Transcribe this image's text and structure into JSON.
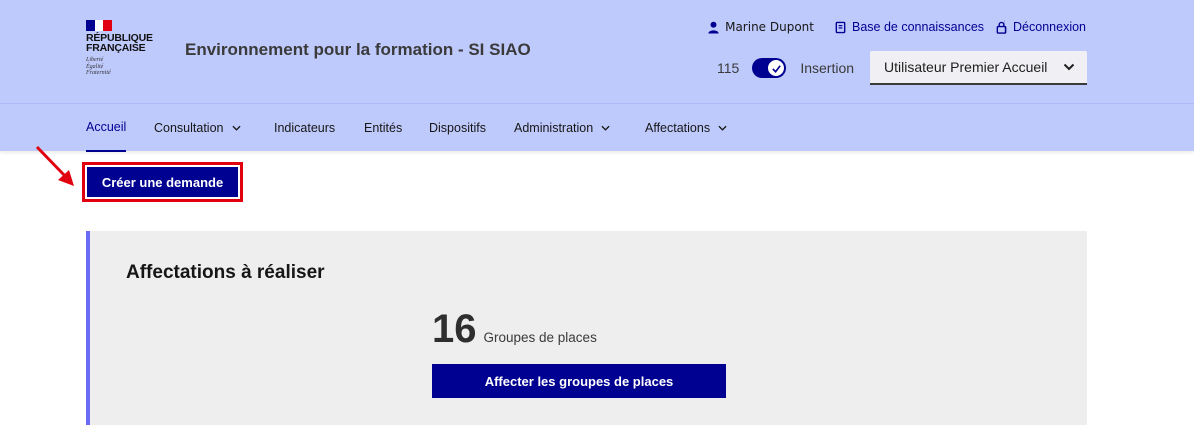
{
  "brand": {
    "flag_colors": [
      "#000091",
      "#ffffff",
      "#e1000f"
    ],
    "title_line1": "RÉPUBLIQUE",
    "title_line2": "FRANÇAISE",
    "motto_line1": "Liberté",
    "motto_line2": "Égalité",
    "motto_line3": "Fraternité"
  },
  "header": {
    "service_title": "Environnement pour la formation - SI SIAO",
    "user_name": "Marine Dupont",
    "knowledge_base_label": "Base de connaissances",
    "logout_label": "Déconnexion",
    "count": "115",
    "toggle_label": "Insertion",
    "toggle_on": true,
    "profile_select_value": "Utilisateur Premier Accueil"
  },
  "nav": {
    "items": [
      {
        "label": "Accueil",
        "active": true,
        "has_menu": false
      },
      {
        "label": "Consultation",
        "active": false,
        "has_menu": true
      },
      {
        "label": "Indicateurs",
        "active": false,
        "has_menu": false
      },
      {
        "label": "Entités",
        "active": false,
        "has_menu": false
      },
      {
        "label": "Dispositifs",
        "active": false,
        "has_menu": false
      },
      {
        "label": "Administration",
        "active": false,
        "has_menu": true
      },
      {
        "label": "Affectations",
        "active": false,
        "has_menu": true
      }
    ]
  },
  "actions": {
    "create_label": "Créer une demande"
  },
  "panel": {
    "title": "Affectations à réaliser",
    "count": "16",
    "count_label": "Groupes de places",
    "button_label": "Affecter les groupes de places"
  },
  "colors": {
    "header_bg": "#bfcafc",
    "primary": "#000091",
    "highlight": "#e1000f",
    "panel_accent": "#6a6af4"
  }
}
